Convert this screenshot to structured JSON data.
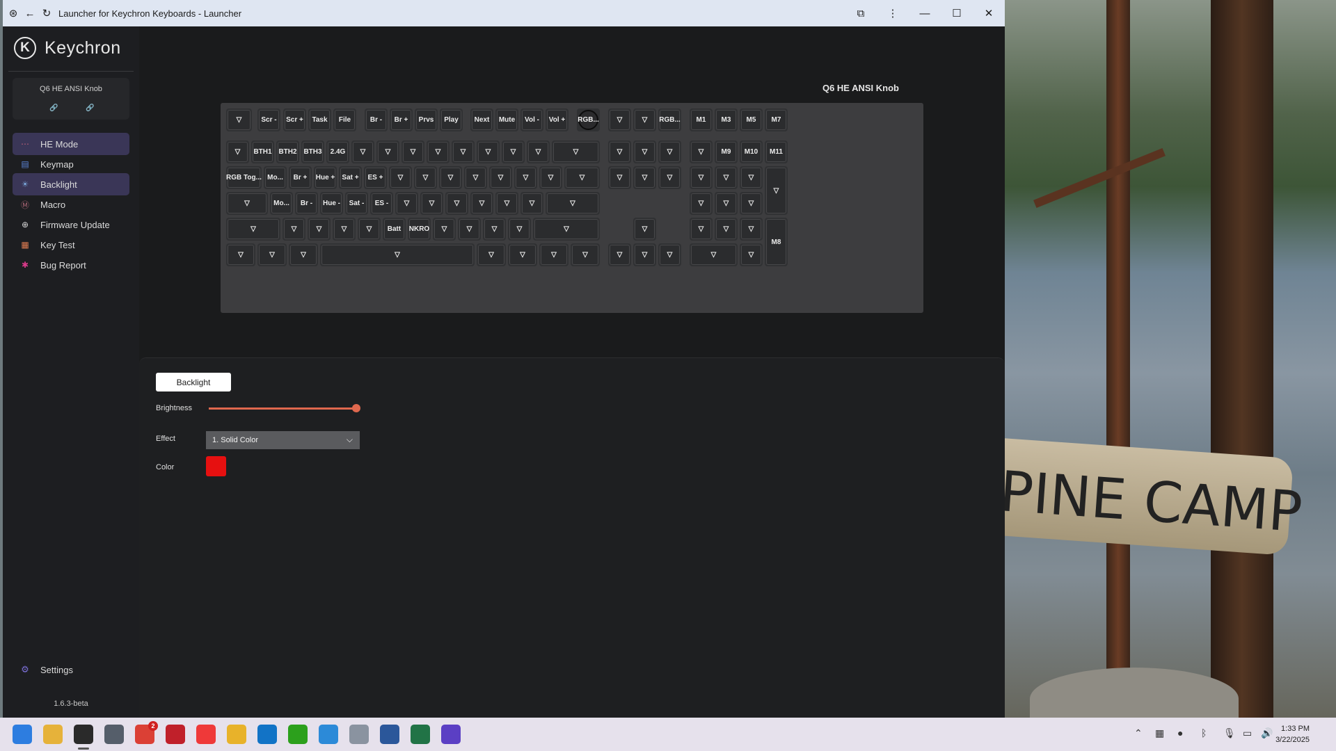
{
  "window": {
    "title": "Launcher for Keychron Keyboards - Launcher"
  },
  "sidebar": {
    "brand": "Keychron",
    "device": {
      "name": "Q6 HE ANSI Knob",
      "icons": [
        "link-icon",
        "unlink-icon"
      ]
    },
    "nav": [
      {
        "label": "HE Mode",
        "icon": "dots-icon",
        "color": "#c0607a",
        "active": true
      },
      {
        "label": "Keymap",
        "icon": "keyboard-icon",
        "color": "#5b84d6",
        "active": false
      },
      {
        "label": "Backlight",
        "icon": "bulb-icon",
        "color": "#7aa6d9",
        "active": true
      },
      {
        "label": "Macro",
        "icon": "m-circle-icon",
        "color": "#b06878",
        "active": false
      },
      {
        "label": "Firmware Update",
        "icon": "plus-circle-icon",
        "color": "#d8d8d8",
        "active": false
      },
      {
        "label": "Key Test",
        "icon": "calendar-icon",
        "color": "#e07d52",
        "active": false
      },
      {
        "label": "Bug Report",
        "icon": "bug-icon",
        "color": "#d83a8a",
        "active": false
      }
    ],
    "settings_label": "Settings",
    "version": "1.6.3-beta"
  },
  "keyboard": {
    "title": "Q6 HE ANSI Knob",
    "knob_label": "RGB...",
    "rows": [
      [
        "▽",
        "Scr -",
        "Scr +",
        "Task",
        "File",
        "Br -",
        "Br +",
        "Prvs",
        "Play",
        "Next",
        "Mute",
        "Vol -",
        "Vol +",
        "RGB...",
        "▽",
        "▽",
        "RGB...",
        "M1",
        "M3",
        "M5",
        "M7"
      ],
      [
        "▽",
        "BTH1",
        "BTH2",
        "BTH3",
        "2.4G",
        "▽",
        "▽",
        "▽",
        "▽",
        "▽",
        "▽",
        "▽",
        "▽",
        "▽",
        "▽",
        "▽",
        "▽",
        "▽",
        "M9",
        "M10",
        "M11"
      ],
      [
        "RGB Tog...",
        "Mo...",
        "Br +",
        "Hue +",
        "Sat +",
        "ES +",
        "▽",
        "▽",
        "▽",
        "▽",
        "▽",
        "▽",
        "▽",
        "▽",
        "▽",
        "▽",
        "▽",
        "▽",
        "▽",
        "▽",
        "▽"
      ],
      [
        "▽",
        "Mo...",
        "Br -",
        "Hue -",
        "Sat -",
        "ES -",
        "▽",
        "▽",
        "▽",
        "▽",
        "▽",
        "▽",
        "▽",
        "▽",
        "▽",
        "▽"
      ],
      [
        "▽",
        "▽",
        "▽",
        "▽",
        "▽",
        "Batt",
        "NKRO",
        "▽",
        "▽",
        "▽",
        "▽",
        "▽",
        "▽",
        "▽",
        "▽",
        "▽",
        "M8"
      ],
      [
        "▽",
        "▽",
        "▽",
        "▽",
        "▽",
        "▽",
        "▽",
        "▽",
        "▽",
        "▽",
        "▽",
        "▽",
        "▽"
      ]
    ]
  },
  "backlight": {
    "tab_label": "Backlight",
    "brightness_label": "Brightness",
    "brightness_value": 1.0,
    "effect_label": "Effect",
    "effect_value": "1. Solid Color",
    "color_label": "Color",
    "color_value": "#e61010",
    "accent": "#e0684e"
  },
  "taskbar": {
    "apps": [
      {
        "name": "start-icon",
        "color": "#2d7de0"
      },
      {
        "name": "file-explorer-icon",
        "color": "#e6b23a"
      },
      {
        "name": "keychron-launcher-icon",
        "color": "#2a2a2a"
      },
      {
        "name": "calculator-icon",
        "color": "#555e6a"
      },
      {
        "name": "todoist-icon",
        "color": "#db4035",
        "badge": "2"
      },
      {
        "name": "app-icon-red",
        "color": "#c0202a"
      },
      {
        "name": "vivaldi-icon",
        "color": "#ef3939"
      },
      {
        "name": "chrome-icon",
        "color": "#e8b22a"
      },
      {
        "name": "outlook-icon",
        "color": "#1273c6"
      },
      {
        "name": "quickbooks-icon",
        "color": "#2ca01c"
      },
      {
        "name": "snipping-tool-icon",
        "color": "#2c8ad8"
      },
      {
        "name": "printer-icon",
        "color": "#8a93a0"
      },
      {
        "name": "word-icon",
        "color": "#2b579a"
      },
      {
        "name": "excel-icon",
        "color": "#217346"
      },
      {
        "name": "screen-recorder-icon",
        "color": "#5b3fc4"
      }
    ],
    "time": "1:33 PM",
    "date": "3/22/2025"
  }
}
